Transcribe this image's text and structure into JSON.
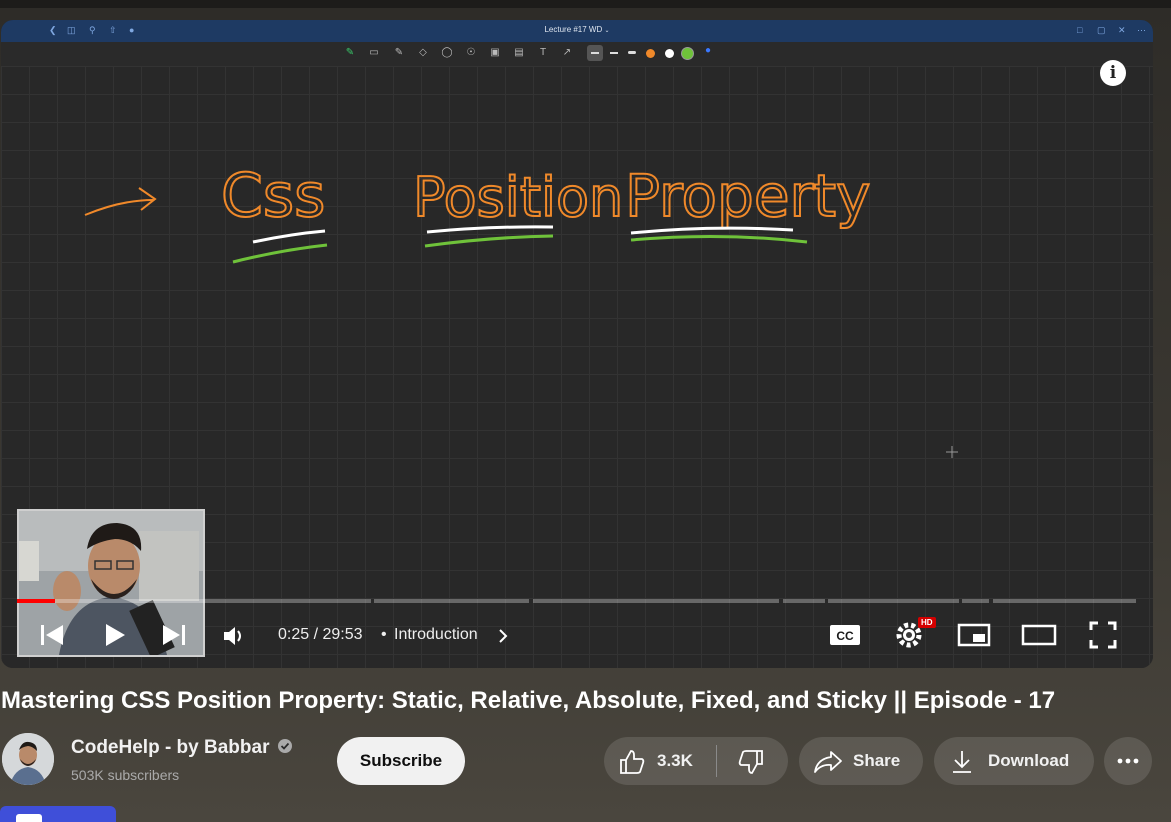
{
  "app": {
    "title": "Lecture #17 WD"
  },
  "whiteboard": {
    "words": [
      "Css",
      "Position",
      "Property"
    ]
  },
  "player": {
    "current_time": "0:25",
    "separator": "/",
    "duration": "29:53",
    "chapter_bullet": "•",
    "chapter": "Introduction",
    "settings_badge": "HD",
    "progress_fraction": 0.0084
  },
  "video": {
    "title": "Mastering CSS Position Property: Static, Relative, Absolute, Fixed, and Sticky || Episode - 17"
  },
  "channel": {
    "name": "CodeHelp - by Babbar",
    "subscribers": "503K subscribers"
  },
  "actions": {
    "subscribe": "Subscribe",
    "likes": "3.3K",
    "share": "Share",
    "download": "Download"
  },
  "colors": {
    "accent_orange": "#f0892a",
    "underline_green": "#6fc23a",
    "progress_red": "#ff0000",
    "bottom_button": "#3f4fd9"
  }
}
